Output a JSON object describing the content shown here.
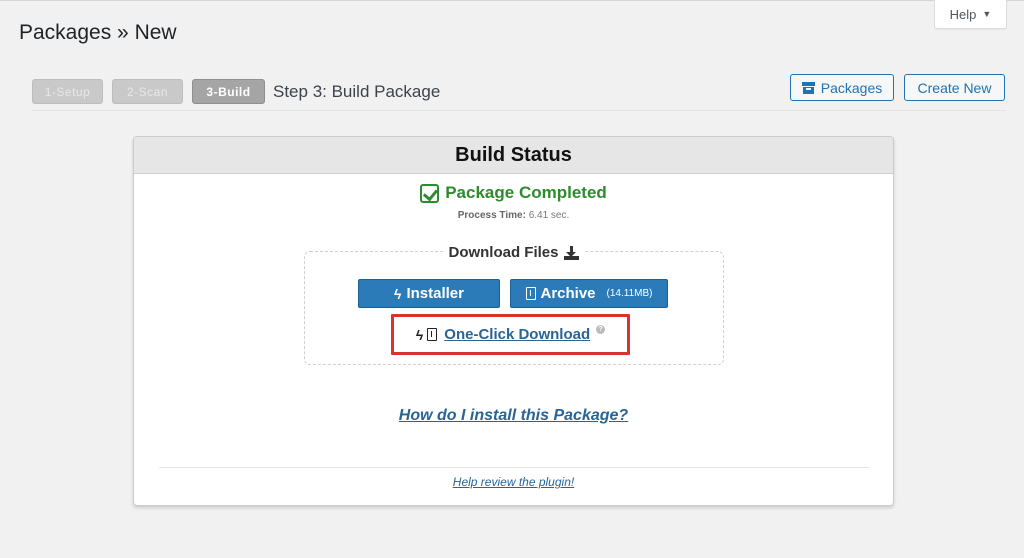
{
  "help": {
    "label": "Help",
    "caret": "▼"
  },
  "page": {
    "title": "Packages » New"
  },
  "steps": {
    "items": [
      {
        "label": "1-Setup"
      },
      {
        "label": "2-Scan"
      },
      {
        "label": "3-Build"
      }
    ],
    "title": "Step 3: Build Package"
  },
  "toolbar": {
    "packages_label": "Packages",
    "create_label": "Create New"
  },
  "panel": {
    "title": "Build Status",
    "status": "Package Completed",
    "process_label": "Process Time:",
    "process_value": "6.41 sec.",
    "download_title": "Download Files",
    "installer_label": "Installer",
    "archive_label": "Archive",
    "archive_size": "(14.11MB)",
    "oneclick_label": "One-Click Download",
    "help_q": "?",
    "howto_label": "How do I install this Package?",
    "review_label": "Help review the plugin!"
  },
  "colors": {
    "accent": "#2271b1",
    "success": "#2e8b2e",
    "button": "#2a7bb8",
    "highlight": "#d9342b"
  },
  "icons": [
    "check-square-icon",
    "download-icon",
    "bolt-icon",
    "file-zip-icon",
    "archive-box-icon",
    "help-icon",
    "caret-down-icon"
  ]
}
